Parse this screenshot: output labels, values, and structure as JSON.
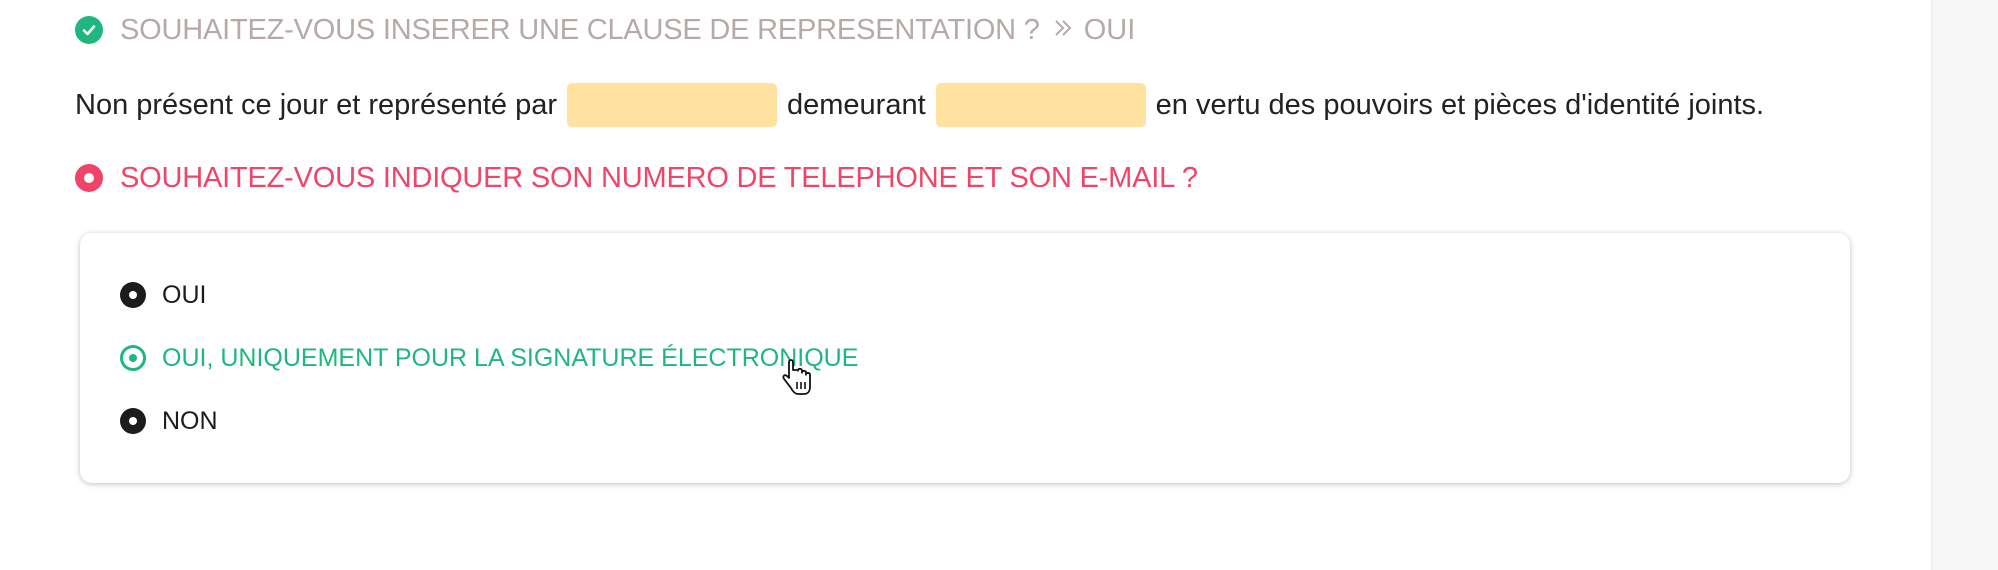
{
  "question1": {
    "label": "SOUHAITEZ-VOUS INSERER UNE CLAUSE DE REPRESENTATION ?",
    "chevron": "»",
    "answer": "OUI",
    "status_icon": "check-circle-icon",
    "status_color": "#1fb77f"
  },
  "sentence": {
    "part1": "Non présent ce jour et représenté par",
    "part2": "demeurant",
    "part3": "en vertu des pouvoirs et pièces d'identité joints.",
    "blank_color": "#ffe1a0"
  },
  "question2": {
    "label": "SOUHAITEZ-VOUS INDIQUER SON NUMERO DE TELEPHONE ET SON E-MAIL ?",
    "status_icon": "radio-active-icon",
    "status_color": "#f04468"
  },
  "options": [
    {
      "label": "OUI",
      "selected": false
    },
    {
      "label": "OUI, UNIQUEMENT POUR LA SIGNATURE ÉLECTRONIQUE",
      "selected": true,
      "color": "#1fb77f"
    },
    {
      "label": "NON",
      "selected": false
    }
  ],
  "cursor_icon": "hand-pointer-icon"
}
